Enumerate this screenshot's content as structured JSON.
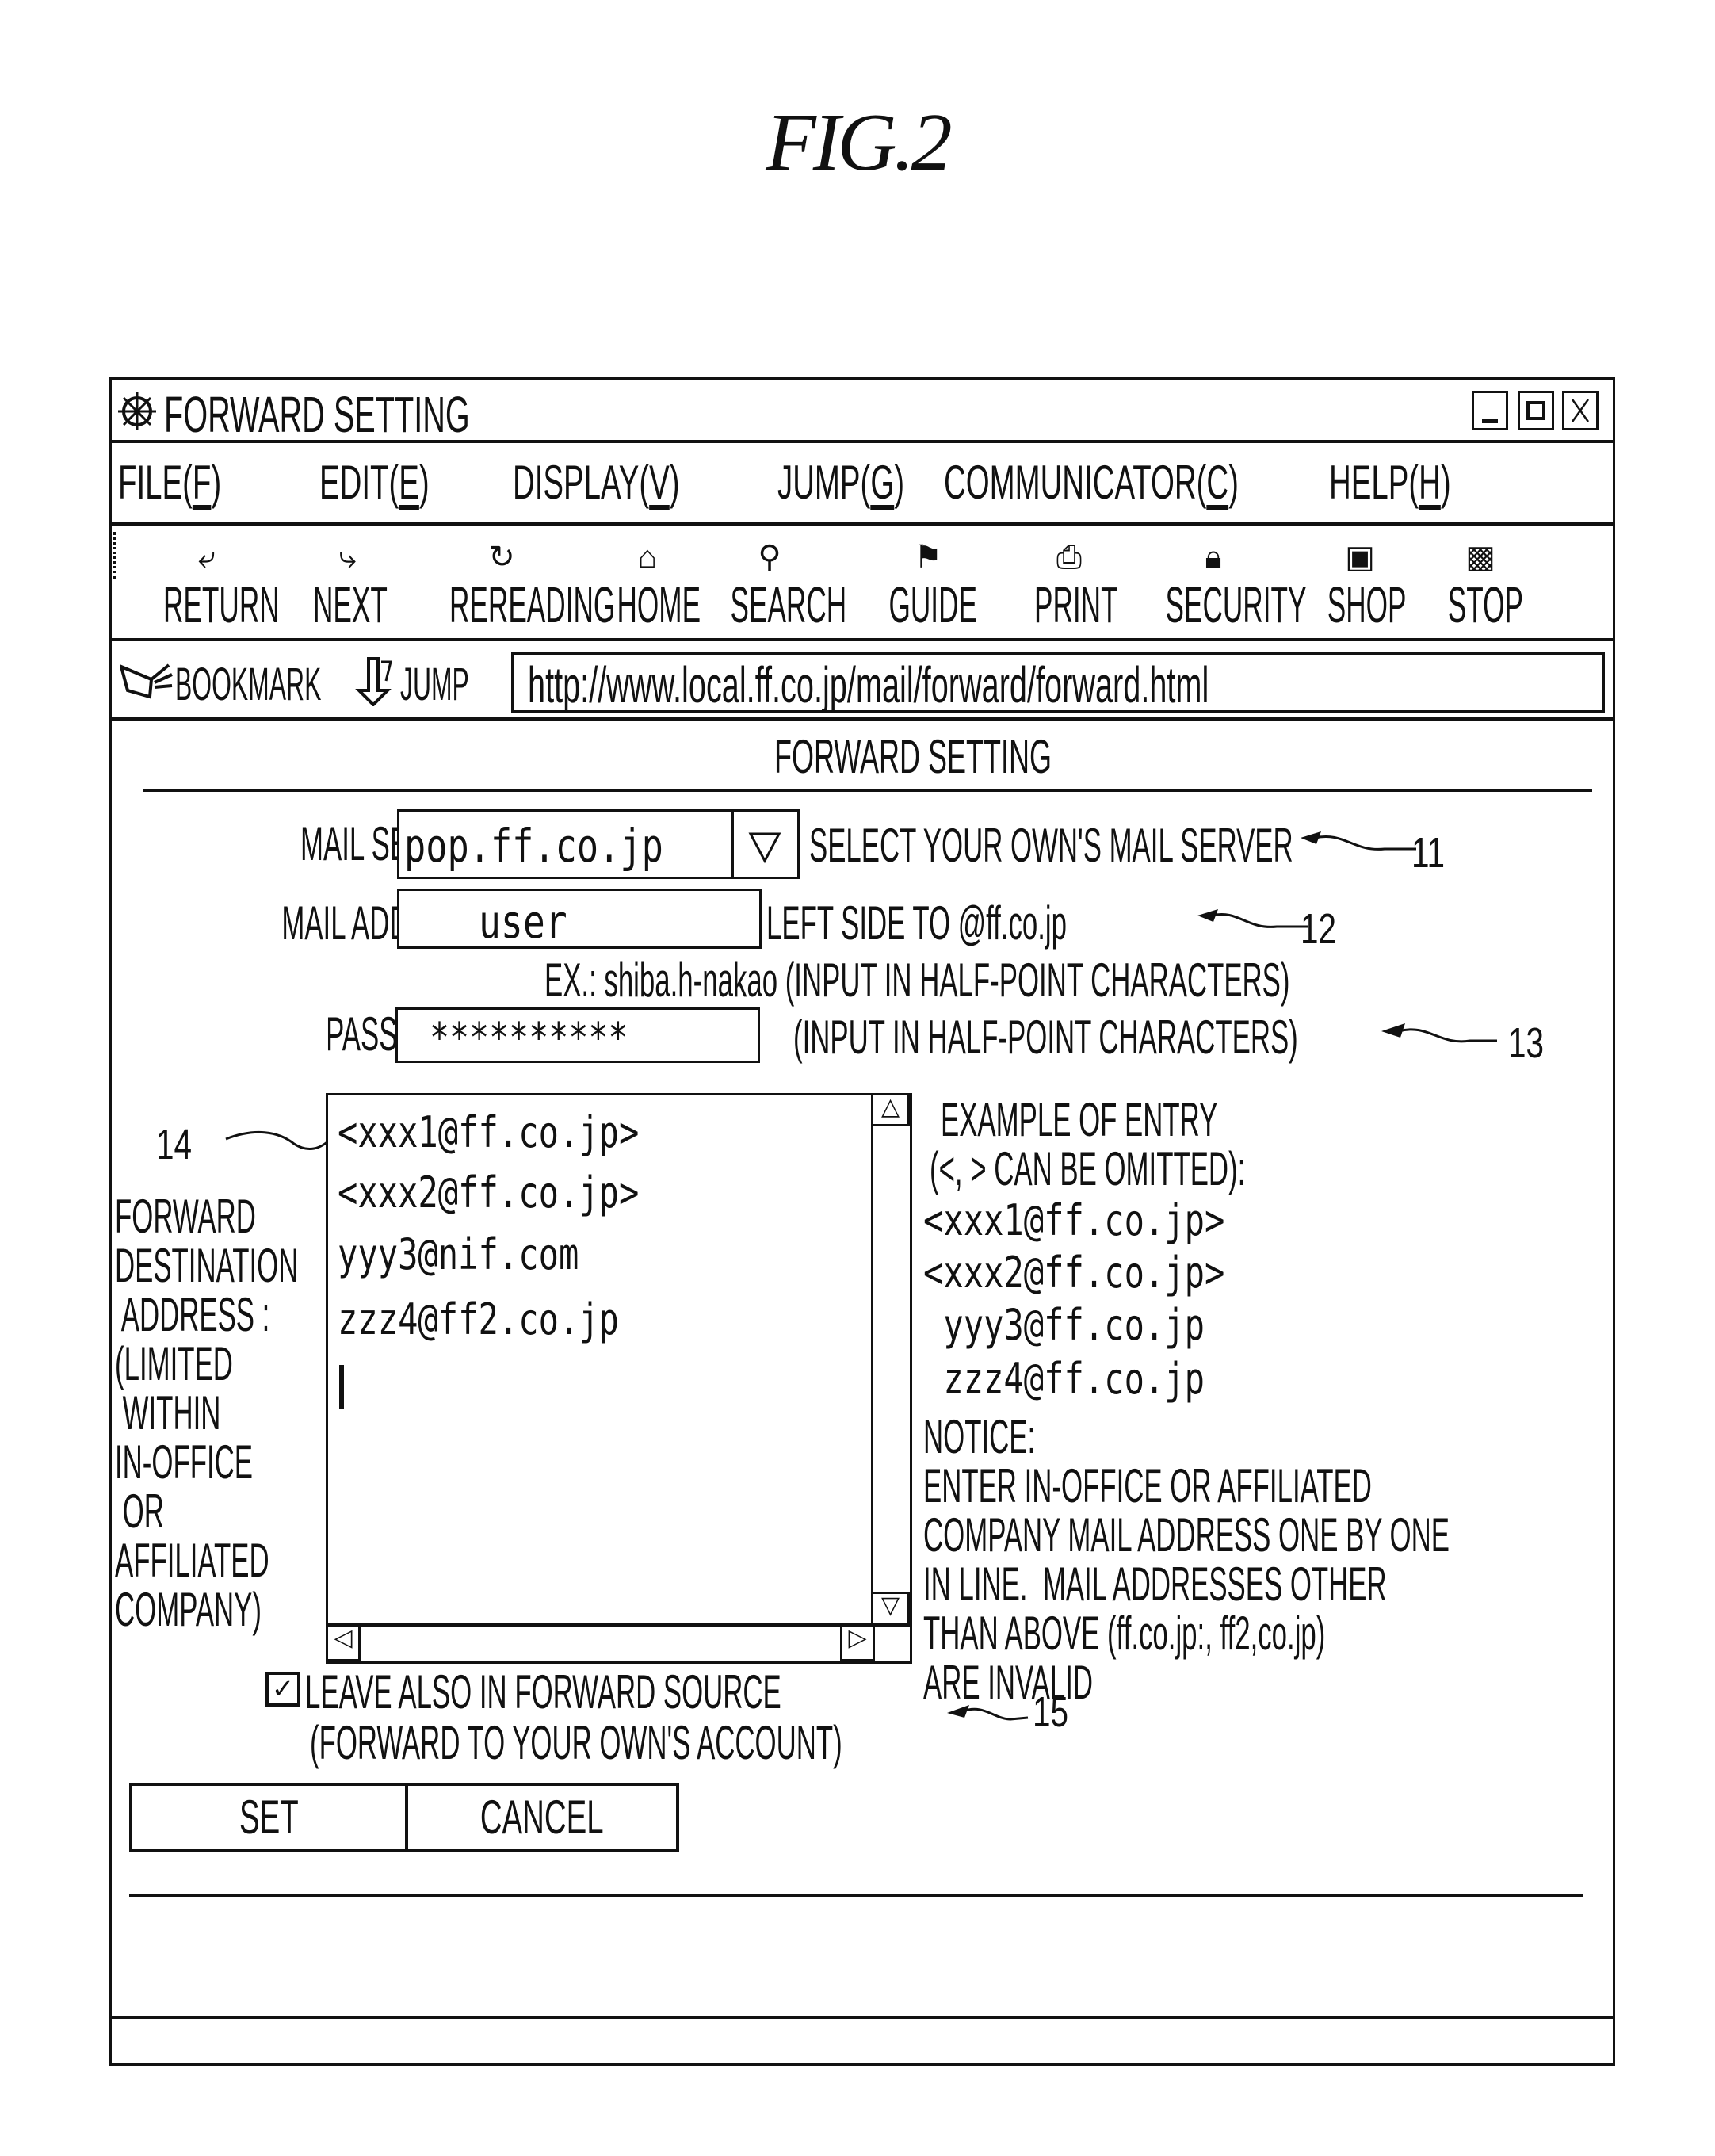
{
  "figure": {
    "label": "FIG.2"
  },
  "window": {
    "title": "FORWARD SETTING",
    "icons": {
      "app": "ships-wheel-icon",
      "minimize": "minimize-icon",
      "maximize": "maximize-icon",
      "close": "close-icon"
    },
    "controls": {
      "minimize": "_",
      "maximize": "□",
      "close": "X"
    }
  },
  "menu": [
    {
      "label": "FILE(",
      "key": "F",
      "end": ")"
    },
    {
      "label": "EDIT(",
      "key": "E",
      "end": ")"
    },
    {
      "label": "DISPLAY(",
      "key": "V",
      "end": ")"
    },
    {
      "label": "JUMP(",
      "key": "G",
      "end": ")"
    },
    {
      "label": "COMMUNICATOR(",
      "key": "C",
      "end": ")"
    },
    {
      "label": "HELP(",
      "key": "H",
      "end": ")"
    }
  ],
  "toolbar": [
    {
      "label": "RETURN",
      "icon": "back-arrow-icon"
    },
    {
      "label": "NEXT",
      "icon": "forward-arrow-icon"
    },
    {
      "label": "REREADING",
      "icon": "reload-icon"
    },
    {
      "label": "HOME",
      "icon": "home-icon"
    },
    {
      "label": "SEARCH",
      "icon": "search-icon"
    },
    {
      "label": "GUIDE",
      "icon": "guide-icon"
    },
    {
      "label": "PRINT",
      "icon": "print-icon"
    },
    {
      "label": "SECURITY",
      "icon": "lock-icon"
    },
    {
      "label": "SHOP",
      "icon": "shop-icon"
    },
    {
      "label": "STOP",
      "icon": "stop-icon"
    }
  ],
  "addressbar": {
    "bookmark_label": "BOOKMARK",
    "jump_label": "JUMP",
    "url": "http://www.local.ff.co.jp/mail/forward/forward.html"
  },
  "page": {
    "heading": "FORWARD SETTING",
    "mail_server": {
      "label": "MAIL SERVER:",
      "value": "pop.ff.co.jp",
      "hint": "SELECT YOUR OWN'S MAIL SERVER",
      "callout": "11"
    },
    "mail_address": {
      "label": "MAIL ADDRESS:",
      "value": "user",
      "hint": "LEFT SIDE TO @ff.co.jp",
      "callout": "12",
      "example": "EX.: shiba.h-nakao (INPUT IN  HALF-POINT CHARACTERS)"
    },
    "password": {
      "label": "PASSWORD:",
      "value": "**********",
      "hint": "(INPUT IN HALF-POINT CHARACTERS)",
      "callout": "13"
    },
    "forward_destination": {
      "label_lines": [
        "FORWARD",
        "DESTINATION",
        " ADDRESS :",
        "(LIMITED",
        " WITHIN",
        "IN-OFFICE",
        " OR",
        "AFFILIATED",
        "COMPANY)"
      ],
      "callout": "14",
      "entries": [
        "<xxx1@ff.co.jp>",
        "<xxx2@ff.co.jp>",
        "yyy3@nif.com",
        "zzz4@ff2.co.jp"
      ]
    },
    "example": {
      "lines": [
        "EXAMPLE OF ENTRY",
        "(<, > CAN BE OMITTED):"
      ],
      "entries": [
        "<xxx1@ff.co.jp>",
        "<xxx2@ff.co.jp>",
        " yyy3@ff.co.jp",
        " zzz4@ff.co.jp"
      ],
      "notice_lines": [
        "NOTICE:",
        "ENTER IN-OFFICE OR AFFILIATED",
        "COMPANY MAIL ADDRESS ONE BY ONE",
        "IN LINE.  MAIL ADDRESSES OTHER",
        "THAN ABOVE (ff.co.jp:, ff2,co.jp)",
        "ARE INVALID"
      ],
      "callout": "15"
    },
    "leave_source": {
      "checked": true,
      "line1": "LEAVE ALSO IN FORWARD SOURCE",
      "line2": "(FORWARD TO YOUR OWN'S ACCOUNT)"
    },
    "buttons": {
      "set": "SET",
      "cancel": "CANCEL"
    }
  }
}
